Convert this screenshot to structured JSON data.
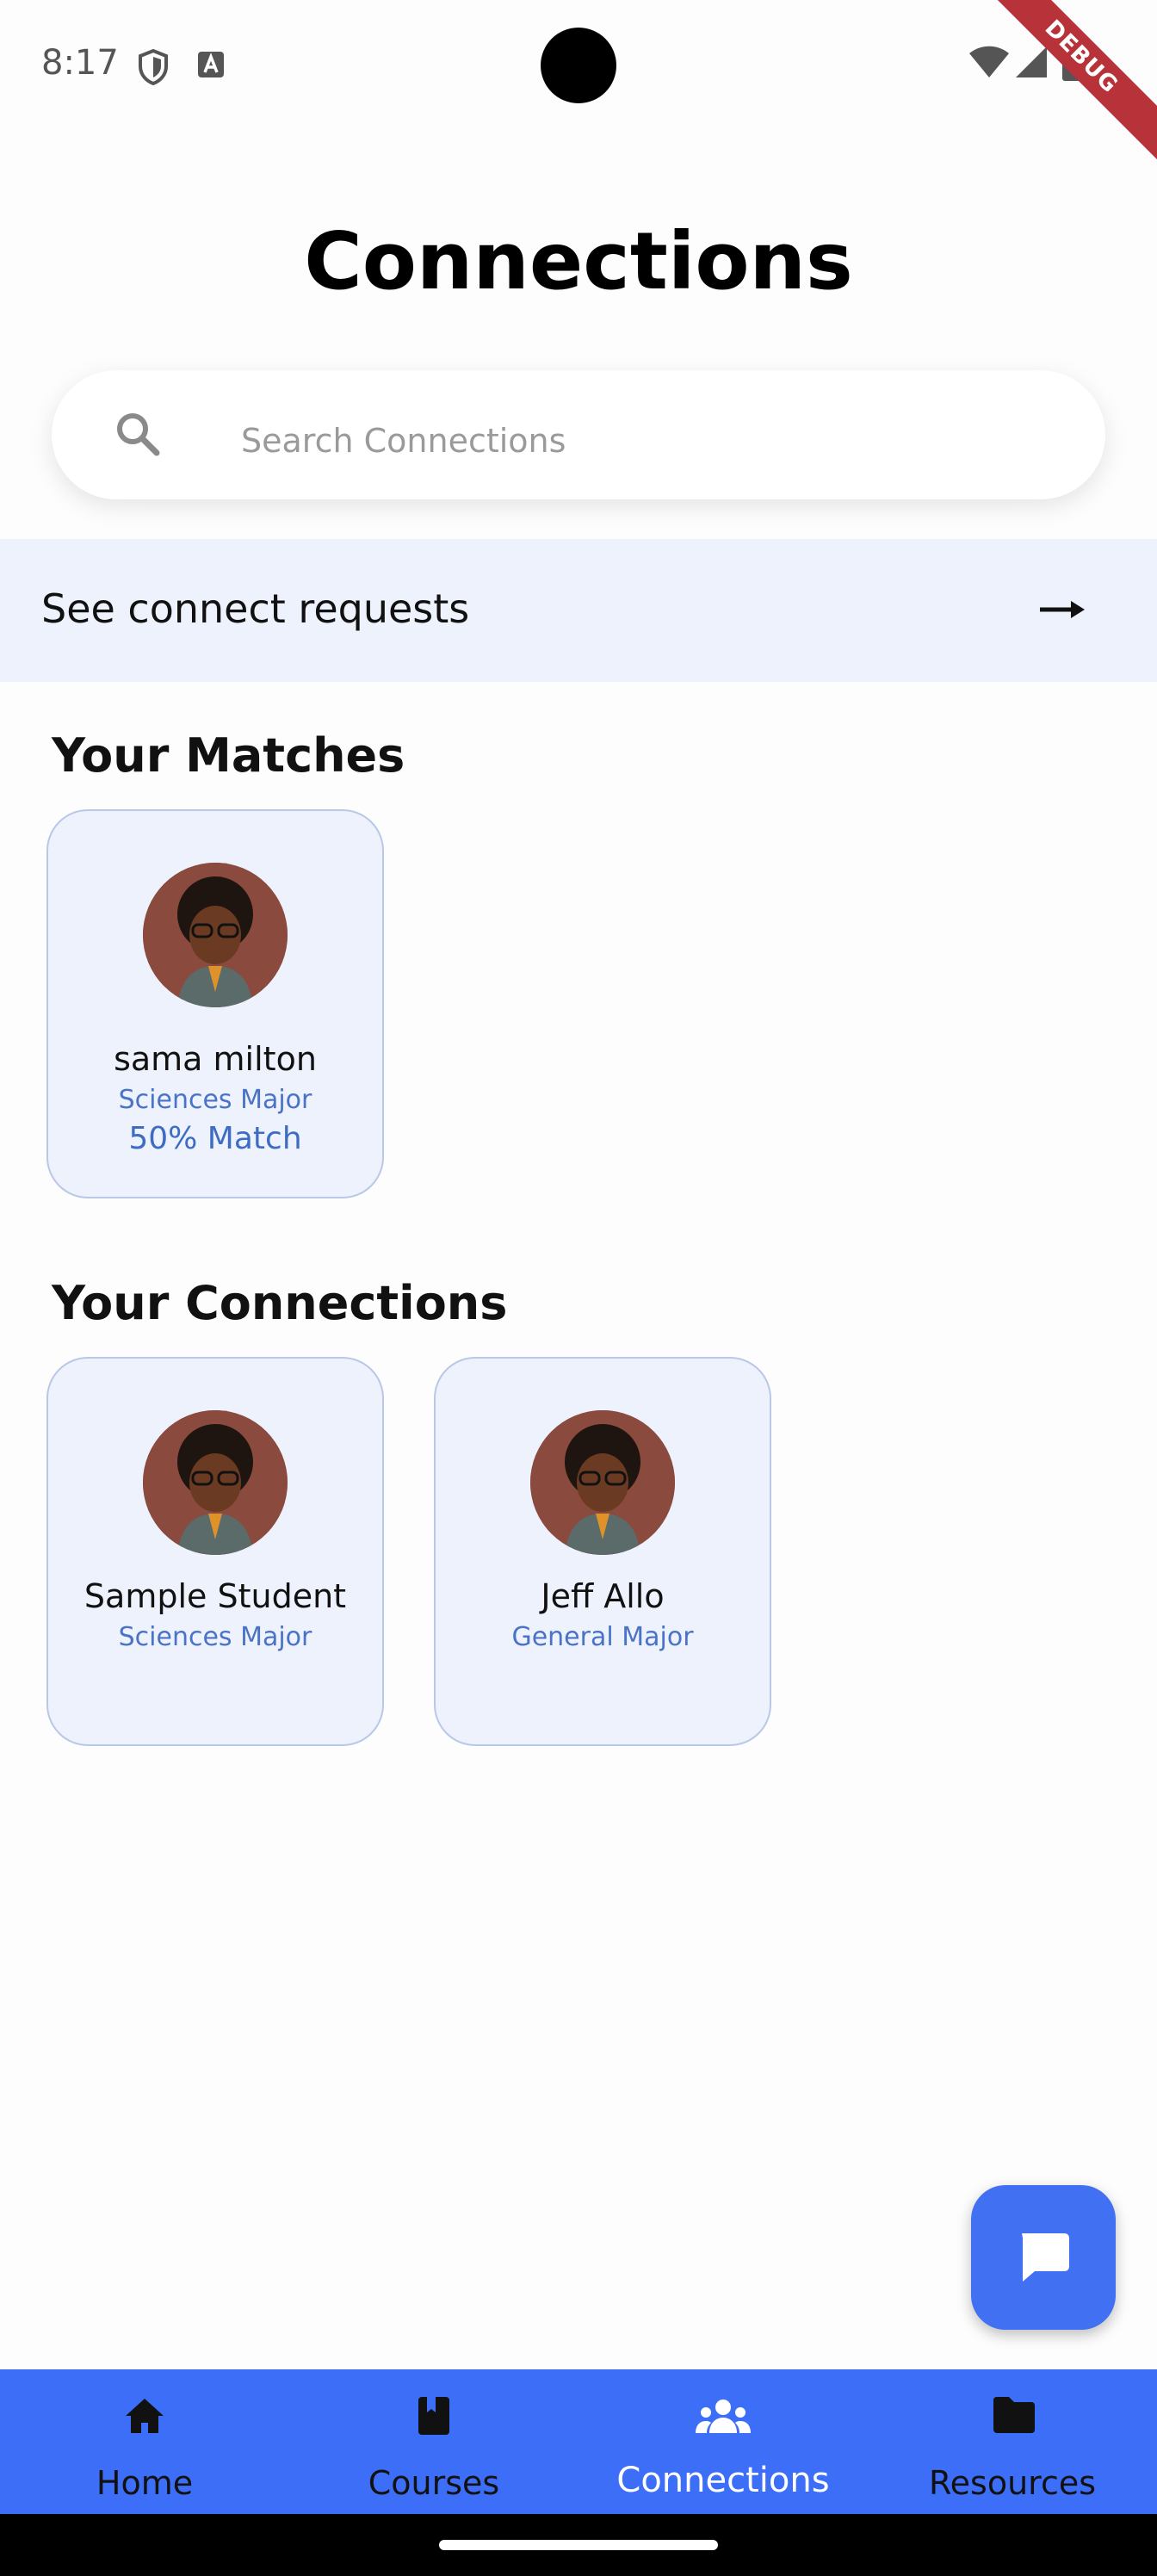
{
  "status_bar": {
    "time": "8:17",
    "debug_label": "DEBUG"
  },
  "page": {
    "title": "Connections"
  },
  "search": {
    "placeholder": "Search Connections",
    "value": ""
  },
  "requests": {
    "label": "See connect requests"
  },
  "matches": {
    "title": "Your Matches",
    "items": [
      {
        "name": "sama milton",
        "major": "Sciences Major",
        "match": "50% Match"
      }
    ]
  },
  "connections": {
    "title": "Your Connections",
    "items": [
      {
        "name": "Sample Student",
        "major": "Sciences Major"
      },
      {
        "name": "Jeff Allo",
        "major": "General Major"
      }
    ]
  },
  "fab": {
    "icon": "chat-bubble-icon"
  },
  "nav": {
    "active": "Connections",
    "items": [
      {
        "label": "Home",
        "icon": "home-icon"
      },
      {
        "label": "Courses",
        "icon": "book-icon"
      },
      {
        "label": "Connections",
        "icon": "people-icon"
      },
      {
        "label": "Resources",
        "icon": "folder-icon"
      }
    ]
  },
  "colors": {
    "accent": "#3d6ef7",
    "card_bg": "#edf2fd",
    "major_text": "#4a73c8"
  }
}
